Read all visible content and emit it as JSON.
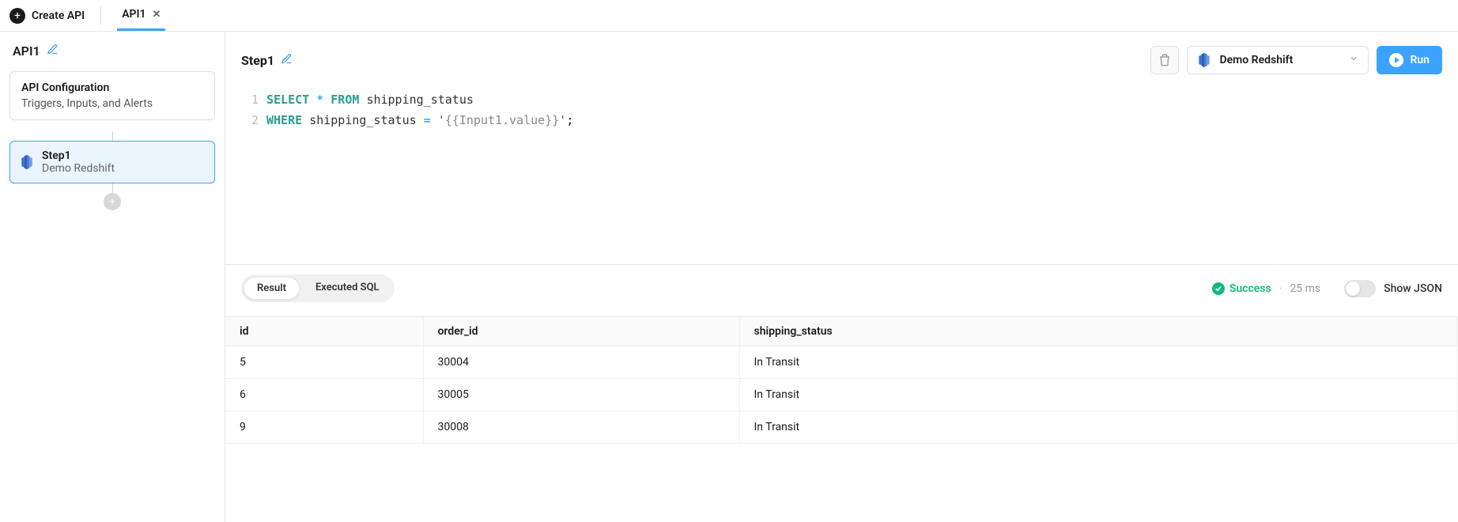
{
  "topbar": {
    "create_label": "Create API",
    "tab_label": "API1"
  },
  "sidebar": {
    "api_name": "API1",
    "config": {
      "title": "API Configuration",
      "subtitle": "Triggers, Inputs, and Alerts"
    },
    "step": {
      "title": "Step1",
      "subtitle": "Demo Redshift"
    }
  },
  "editor": {
    "step_name": "Step1",
    "db_name": "Demo Redshift",
    "run_label": "Run",
    "code": [
      {
        "n": "1",
        "html": "<span class='kw'>SELECT</span> <span class='num-op'>*</span> <span class='kw'>FROM</span> <span class='ident'>shipping_status</span>"
      },
      {
        "n": "2",
        "html": "<span class='kw'>WHERE</span> <span class='ident'>shipping_status</span> <span class='num-op'>=</span> <span class='str'>'</span><span class='tpl'>{{Input1.value}}</span><span class='str'>'</span>;"
      }
    ]
  },
  "results": {
    "tab_result": "Result",
    "tab_exec": "Executed SQL",
    "status_label": "Success",
    "timing": "25 ms",
    "show_json_label": "Show JSON",
    "columns": [
      "id",
      "order_id",
      "shipping_status"
    ],
    "rows": [
      [
        "5",
        "30004",
        "In Transit"
      ],
      [
        "6",
        "30005",
        "In Transit"
      ],
      [
        "9",
        "30008",
        "In Transit"
      ]
    ]
  }
}
